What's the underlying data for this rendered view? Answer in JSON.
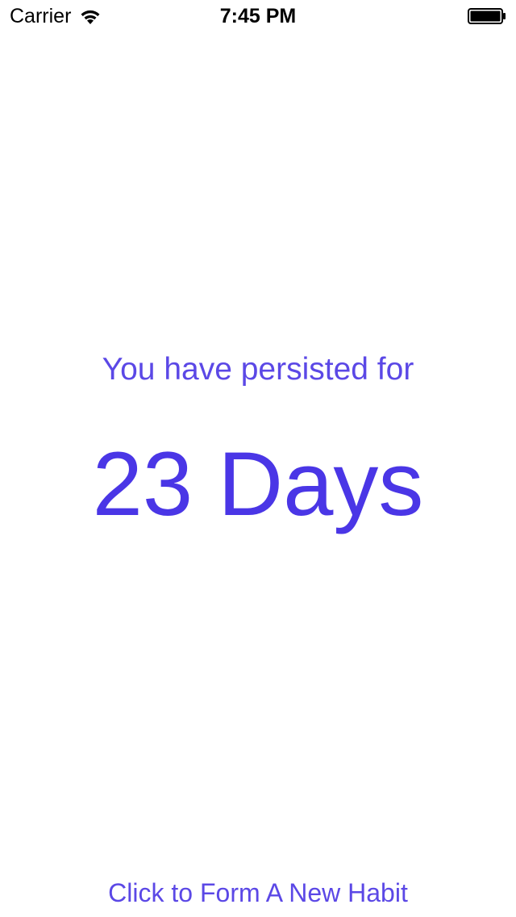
{
  "status_bar": {
    "carrier": "Carrier",
    "time": "7:45 PM",
    "wifi_icon": "wifi-icon",
    "battery_icon": "battery-icon",
    "battery_level": 1.0
  },
  "main": {
    "subtitle": "You have persisted for",
    "days_count": "23 Days"
  },
  "footer": {
    "new_habit_label": "Click to Form A New Habit"
  },
  "colors": {
    "accent": "#5b48e6",
    "background": "#ffffff",
    "text": "#000000"
  }
}
